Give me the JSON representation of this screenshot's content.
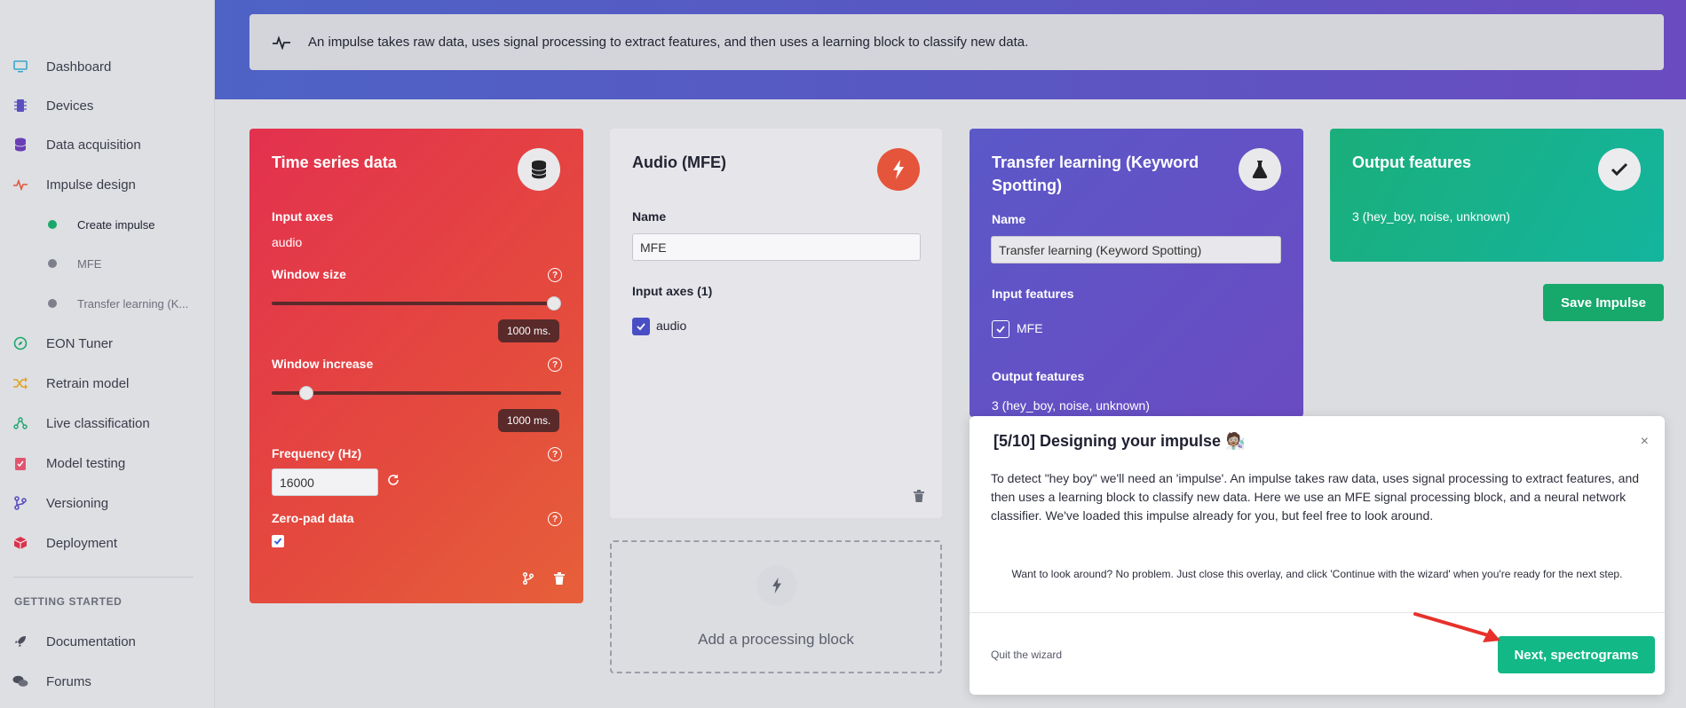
{
  "sidebar": {
    "items": [
      {
        "label": "Dashboard",
        "icon": "monitor-icon",
        "color": "#3aa7c9"
      },
      {
        "label": "Devices",
        "icon": "chip-icon",
        "color": "#5b4fc0"
      },
      {
        "label": "Data acquisition",
        "icon": "database-icon",
        "color": "#6a3fb5"
      },
      {
        "label": "Impulse design",
        "icon": "pulse-icon",
        "color": "#e2553a"
      }
    ],
    "subitems": [
      {
        "label": "Create impulse",
        "active": true
      },
      {
        "label": "MFE"
      },
      {
        "label": "Transfer learning (K..."
      }
    ],
    "items2": [
      {
        "label": "EON Tuner",
        "icon": "compass-icon",
        "color": "#1aa86a"
      },
      {
        "label": "Retrain model",
        "icon": "shuffle-icon",
        "color": "#e0a322"
      },
      {
        "label": "Live classification",
        "icon": "network-icon",
        "color": "#1aa86a"
      },
      {
        "label": "Model testing",
        "icon": "clipboard-check-icon",
        "color": "#e2556e"
      },
      {
        "label": "Versioning",
        "icon": "branch-icon",
        "color": "#5b4fc0"
      },
      {
        "label": "Deployment",
        "icon": "box-icon",
        "color": "#d9344d"
      }
    ],
    "section": "GETTING STARTED",
    "items3": [
      {
        "label": "Documentation",
        "icon": "rocket-icon"
      },
      {
        "label": "Forums",
        "icon": "chat-icon"
      }
    ]
  },
  "info_bar": {
    "text": "An impulse takes raw data, uses signal processing to extract features, and then uses a learning block to classify new data."
  },
  "time_series": {
    "title": "Time series data",
    "input_axes_label": "Input axes",
    "input_axes_value": "audio",
    "window_size_label": "Window size",
    "window_size_value": "1000 ms.",
    "window_size_fraction": 1.0,
    "window_increase_label": "Window increase",
    "window_increase_value": "1000 ms.",
    "window_increase_fraction": 0.1,
    "frequency_label": "Frequency (Hz)",
    "frequency_value": "16000",
    "zero_pad_label": "Zero-pad data",
    "zero_pad_checked": true
  },
  "mfe": {
    "title": "Audio (MFE)",
    "name_label": "Name",
    "name_value": "MFE",
    "input_axes_label": "Input axes (1)",
    "input_axes_item": "audio"
  },
  "add_block": {
    "label": "Add a processing block"
  },
  "transfer": {
    "title": "Transfer learning (Keyword Spotting)",
    "name_label": "Name",
    "name_value": "Transfer learning (Keyword Spotting)",
    "input_features_label": "Input features",
    "input_feature_item": "MFE",
    "output_features_label": "Output features",
    "output_features_value": "3 (hey_boy, noise, unknown)"
  },
  "output": {
    "title": "Output features",
    "value": "3 (hey_boy, noise, unknown)"
  },
  "save_button": "Save Impulse",
  "wizard": {
    "title": "[5/10] Designing your impulse 🧑🏽‍🔬",
    "close": "×",
    "body": "To detect \"hey boy\" we'll need an 'impulse'. An impulse takes raw data, uses signal processing to extract features, and then uses a learning block to classify new data. Here we use an MFE signal processing block, and a neural network classifier. We've loaded this impulse already for you, but feel free to look around.",
    "hint": "Want to look around? No problem. Just close this overlay, and click 'Continue with the wizard' when you're ready for the next step.",
    "quit": "Quit the wizard",
    "next": "Next, spectrograms"
  },
  "colors": {
    "accent_green": "#12b886",
    "arrow_red": "#e8302a"
  }
}
